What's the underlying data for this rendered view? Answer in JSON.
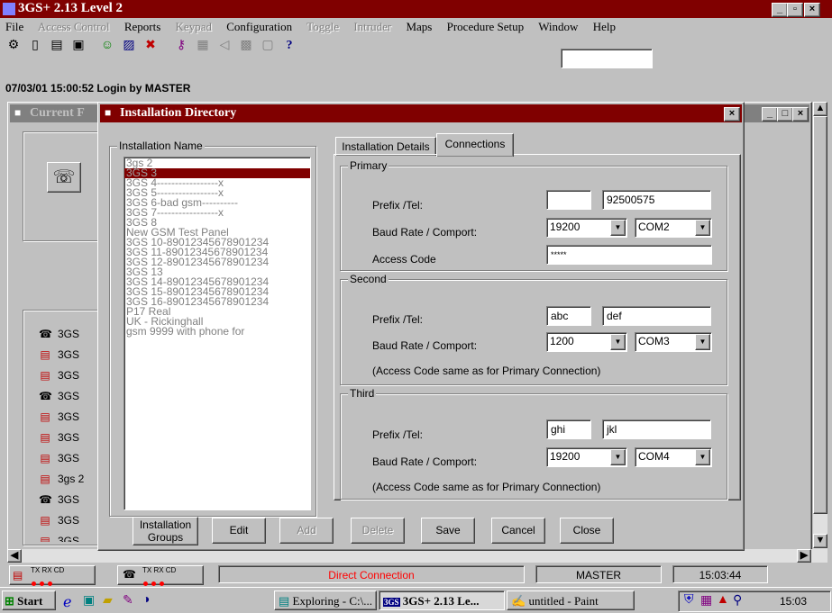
{
  "app": {
    "title": "3GS+ 2.13 Level 2"
  },
  "menu": [
    {
      "label": "File",
      "enabled": true
    },
    {
      "label": "Access Control",
      "enabled": false
    },
    {
      "label": "Reports",
      "enabled": true
    },
    {
      "label": "Keypad",
      "enabled": false
    },
    {
      "label": "Configuration",
      "enabled": true
    },
    {
      "label": "Toggle",
      "enabled": false
    },
    {
      "label": "Intruder",
      "enabled": false
    },
    {
      "label": "Maps",
      "enabled": true
    },
    {
      "label": "Procedure Setup",
      "enabled": true
    },
    {
      "label": "Window",
      "enabled": true
    },
    {
      "label": "Help",
      "enabled": true
    }
  ],
  "status_line": "07/03/01 15:00:52 Login by  MASTER",
  "back_window": {
    "title": "Current F"
  },
  "devices": [
    "3GS",
    "3GS",
    "3GS",
    "3GS",
    "3GS",
    "3GS",
    "3GS",
    "3gs 2",
    "3GS",
    "3GS",
    "3GS"
  ],
  "dialog": {
    "title": "Installation Directory",
    "list_group_label": "Installation Name",
    "installations": [
      "3gs 2",
      "3GS 3",
      "3GS 4-----------------x",
      "3GS 5-----------------x",
      "3GS 6-bad gsm----------",
      "3GS 7-----------------x",
      "3GS 8",
      "New GSM Test Panel",
      "3GS 10-89012345678901234",
      "3GS 11-89012345678901234",
      "3GS 12-89012345678901234",
      "3GS 13",
      "3GS 14-89012345678901234",
      "3GS 15-89012345678901234",
      "3GS 16-89012345678901234",
      "P17 Real",
      "UK - Rickinghall",
      "gsm 9999 with phone for"
    ],
    "tabs": [
      "Installation Details",
      "Connections"
    ],
    "primary": {
      "label": "Primary",
      "prefix_tel_label": "Prefix /Tel:",
      "prefix": "",
      "tel": "92500575",
      "baud_label": "Baud Rate / Comport:",
      "baud": "19200",
      "comport": "COM2",
      "access_code_label": "Access Code",
      "access_code": "*****"
    },
    "second": {
      "label": "Second",
      "prefix_tel_label": "Prefix /Tel:",
      "prefix": "abc",
      "tel": "def",
      "baud_label": "Baud Rate / Comport:",
      "baud": "1200",
      "comport": "COM3",
      "note": "(Access Code same as for Primary Connection)"
    },
    "third": {
      "label": "Third",
      "prefix_tel_label": "Prefix /Tel:",
      "prefix": "ghi",
      "tel": "jkl",
      "baud_label": "Baud Rate / Comport:",
      "baud": "19200",
      "comport": "COM4",
      "note": "(Access Code same as for Primary Connection)"
    },
    "buttons": {
      "groups_line1": "Installation",
      "groups_line2": "Groups",
      "edit": "Edit",
      "add": "Add",
      "delete": "Delete",
      "save": "Save",
      "cancel": "Cancel",
      "close": "Close"
    }
  },
  "statusbar": {
    "txrxcd": "TX RX CD",
    "connection": "Direct Connection",
    "user": "MASTER",
    "time": "15:03:44"
  },
  "taskbar": {
    "start": "Start",
    "tasks": [
      "Exploring - C:\\...",
      "3GS+ 2.13 Le...",
      "untitled - Paint"
    ],
    "clock": "15:03"
  },
  "colors": {
    "titlebar": "#800000",
    "selection": "#800000",
    "connection_text": "#ff0000",
    "desktop_face": "#c0c0c0"
  }
}
